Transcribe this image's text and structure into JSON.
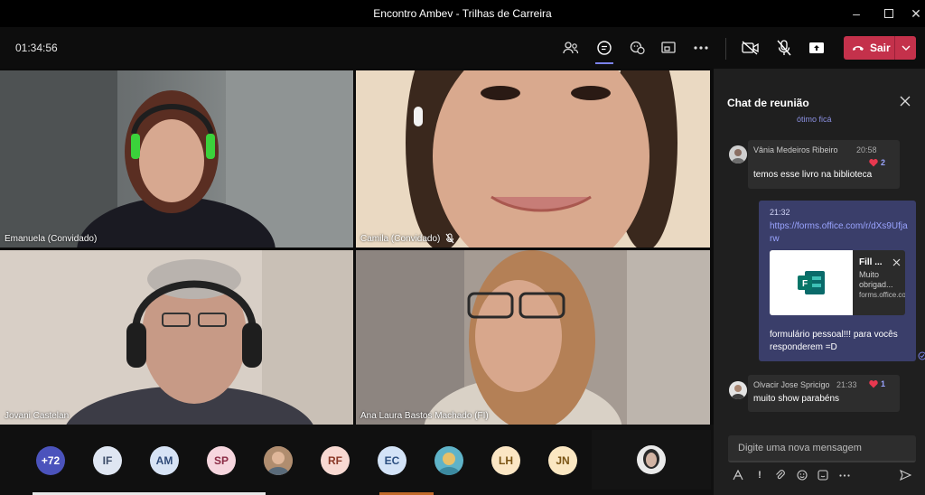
{
  "window": {
    "title": "Encontro Ambev - Trilhas de Carreira",
    "controls": [
      "minimize",
      "maximize",
      "close"
    ]
  },
  "toolbar": {
    "timer": "01:34:56",
    "buttons": [
      "people-icon",
      "chat-icon",
      "reactions-icon",
      "share-tray-icon",
      "more-icon",
      "camera-off-icon",
      "mic-off-icon",
      "share-content-icon"
    ],
    "leave_label": "Sair"
  },
  "participants": [
    {
      "name": "Emanuela (Convidado)",
      "muted": false
    },
    {
      "name": "Camila (Convidado)",
      "muted": true
    },
    {
      "name": "Jovani Castelan",
      "muted": false
    },
    {
      "name": "Ana Laura Bastos Machado (FI)",
      "muted": false
    }
  ],
  "gallery": {
    "more_count": "+72",
    "avatars": [
      {
        "initials": "IF",
        "bg": "#dfe6f2",
        "fg": "#3d4d6a"
      },
      {
        "initials": "AM",
        "bg": "#d7e3f5",
        "fg": "#2f4a78"
      },
      {
        "initials": "SP",
        "bg": "#f6d6de",
        "fg": "#8b2c45"
      },
      {
        "initials": "",
        "photo": true
      },
      {
        "initials": "RF",
        "bg": "#f8d9d2",
        "fg": "#8a3826"
      },
      {
        "initials": "EC",
        "bg": "#d3e3f7",
        "fg": "#2c4f80"
      },
      {
        "initials": "",
        "photo": true
      },
      {
        "initials": "LH",
        "bg": "#fbe6c4",
        "fg": "#7a5414"
      },
      {
        "initials": "JN",
        "bg": "#fbe7c2",
        "fg": "#7a5414"
      }
    ]
  },
  "chat": {
    "title": "Chat de reunião",
    "partial_top": "ótimo ficá",
    "messages": [
      {
        "author": "Vânia Medeiros Ribeiro",
        "time": "20:58",
        "text": "temos esse livro na biblioteca",
        "reactions": "2"
      },
      {
        "time": "21:32",
        "link": "https://forms.office.com/r/dXs9Ufjarw",
        "card_title": "Fill ...",
        "card_desc": "Muito obrigad...",
        "card_domain": "forms.office.com",
        "text": "formulário pessoal!!! para vocês responderem =D"
      },
      {
        "author": "Olvacir Jose Spricigo",
        "time": "21:33",
        "text": "muito show parabéns",
        "reactions": "1"
      }
    ],
    "compose_placeholder": "Digite uma nova mensagem"
  },
  "colors": {
    "accent": "#7b83eb",
    "leave": "#c4314b",
    "heart": "#e8384f",
    "link": "#9aa4ff"
  }
}
